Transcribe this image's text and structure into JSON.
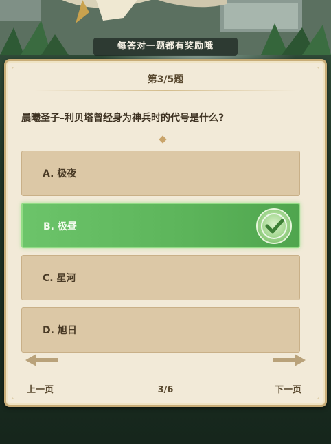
{
  "banner": {
    "text": "每答对一题都有奖励哦"
  },
  "quiz": {
    "progress_title": "第3/5题",
    "question": "晨曦圣子–利贝塔曾经身为神兵时的代号是什么?",
    "options": [
      {
        "label": "A. 极夜",
        "state": "default"
      },
      {
        "label": "B. 极昼",
        "state": "correct"
      },
      {
        "label": "C. 星河",
        "state": "default"
      },
      {
        "label": "D. 旭日",
        "state": "default"
      }
    ]
  },
  "footer": {
    "prev_label": "上一页",
    "next_label": "下一页",
    "page": "3/6"
  },
  "icons": {
    "check": "check-icon",
    "prev_arrow": "arrow-left-icon",
    "next_arrow": "arrow-right-icon"
  },
  "colors": {
    "correct_green": "#5cb45a",
    "option_tan": "#dcc8a6",
    "card_bg": "#f2ead8"
  }
}
